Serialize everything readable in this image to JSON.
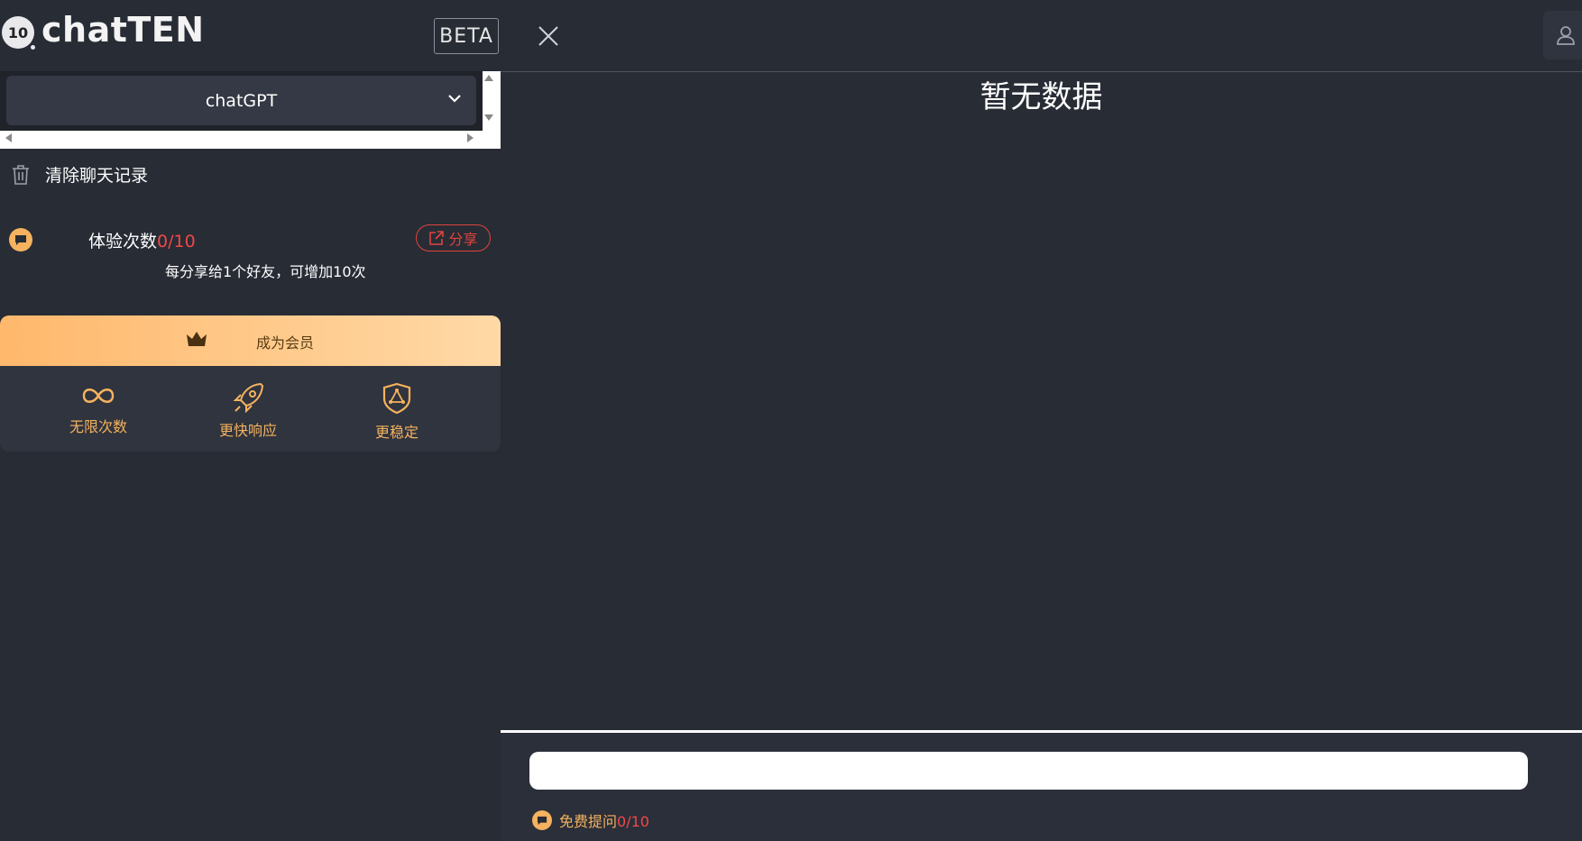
{
  "logo": {
    "badge": "10",
    "name": "chatTEN"
  },
  "beta_label": "BETA",
  "model_select": {
    "value": "chatGPT"
  },
  "clear_history": {
    "label": "清除聊天记录"
  },
  "trial": {
    "label": "体验次数",
    "count": "0/10",
    "share_label": "分享",
    "note": "每分享给1个好友，可增加10次"
  },
  "membership": {
    "label": "成为会员",
    "benefits": [
      {
        "label": "无限次数",
        "icon": "infinity-icon"
      },
      {
        "label": "更快响应",
        "icon": "rocket-icon"
      },
      {
        "label": "更稳定",
        "icon": "shield-icon"
      }
    ]
  },
  "main": {
    "empty_text": "暂无数据"
  },
  "footer": {
    "input_value": "",
    "free_label": "免费提问",
    "free_count": "0/10"
  },
  "colors": {
    "accent": "#f5b25f",
    "danger": "#f04848",
    "bg": "#282c35"
  }
}
